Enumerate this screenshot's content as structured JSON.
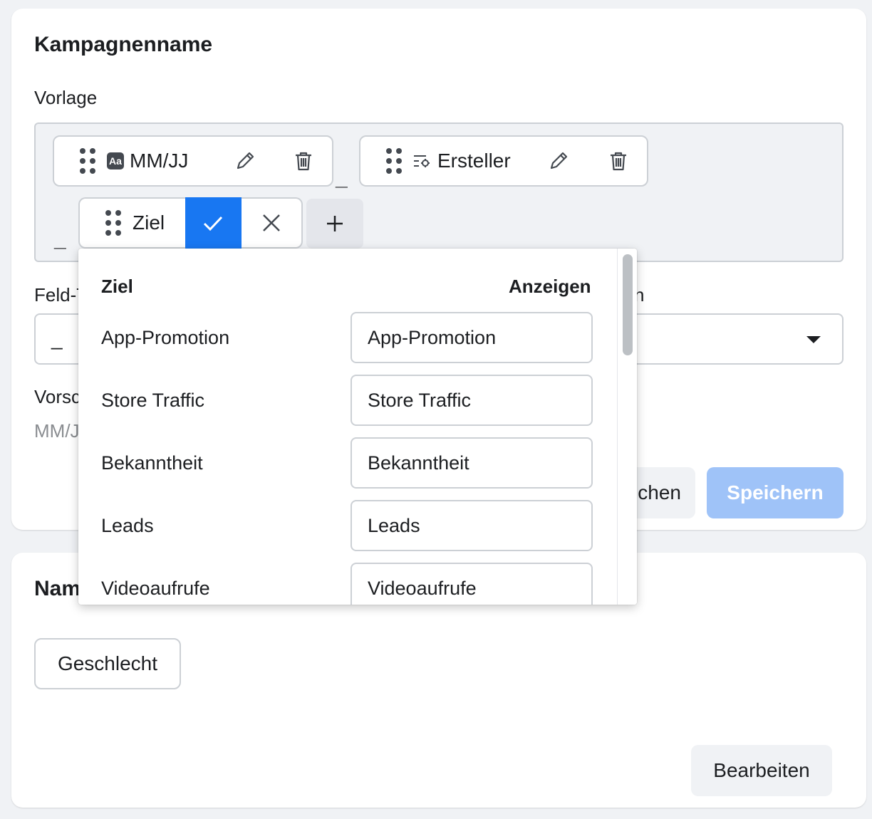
{
  "card1": {
    "title": "Kampagnenname",
    "template_label": "Vorlage",
    "chips": [
      {
        "label": "MM/JJ",
        "type_icon": "text-icon"
      },
      {
        "label": "Ersteller",
        "type_icon": "settings-list-icon"
      }
    ],
    "separator": "_",
    "editing_chip": {
      "label": "Ziel"
    },
    "field_label_partial": "Feld-T",
    "right_label_partial": "n",
    "separator_input_value": "_",
    "preview_label_partial": "Vorsc",
    "preview_value_partial": "MM/J",
    "cancel_button_partial": "chen",
    "save_button": "Speichern"
  },
  "card2": {
    "title_partial": "Nam",
    "gender_button": "Geschlecht",
    "edit_button": "Bearbeiten"
  },
  "popover": {
    "col_left": "Ziel",
    "col_right": "Anzeigen",
    "rows": [
      {
        "label": "App-Promotion",
        "value": "App-Promotion"
      },
      {
        "label": "Store Traffic",
        "value": "Store Traffic"
      },
      {
        "label": "Bekanntheit",
        "value": "Bekanntheit"
      },
      {
        "label": "Leads",
        "value": "Leads"
      },
      {
        "label": "Videoaufrufe",
        "value": "Videoaufrufe"
      }
    ]
  },
  "colors": {
    "accent": "#1877f2",
    "accent_disabled": "#9fc3f8",
    "border": "#ccd0d5"
  }
}
